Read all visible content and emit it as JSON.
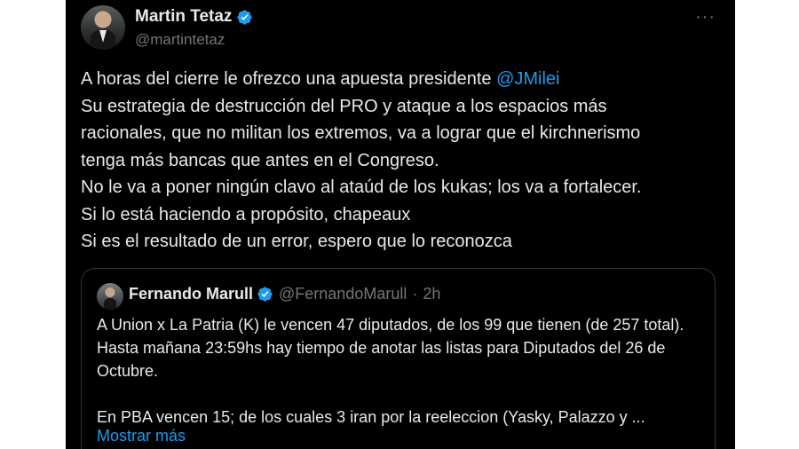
{
  "author": {
    "name": "Martin Tetaz",
    "handle": "@martintetaz"
  },
  "tweet": {
    "lines": [
      "A horas del cierre le ofrezco una apuesta presidente ",
      "@JMilei",
      "Su estrategia de destrucción del PRO y ataque a los espacios más",
      "racionales, que no militan los extremos, va a lograr que el kirchnerismo",
      "tenga más bancas que antes en el Congreso.",
      "No le va a poner ningún clavo al ataúd de los kukas; los va a fortalecer.",
      "Si lo está haciendo a propósito, chapeaux",
      "Si es el resultado de un error, espero que lo reconozca"
    ]
  },
  "quote": {
    "name": "Fernando Marull",
    "handle": "@FernandoMarull",
    "separator": "·",
    "time": "2h",
    "paragraph1": "A Union x La Patria (K) le vencen 47 diputados, de los 99 que tienen (de 257 total). Hasta mañana 23:59hs hay tiempo de anotar las listas para Diputados del 26 de Octubre.",
    "paragraph2": " En PBA vencen 15; de los cuales 3 iran por la reeleccion (Yasky, Palazzo y ...",
    "show_more": "Mostrar más"
  },
  "more_glyph": "···",
  "colors": {
    "background": "#000000",
    "text": "#e7e9ea",
    "secondary": "#71767b",
    "accent": "#1d9bf0",
    "border": "#2f3336"
  },
  "icons": [
    "verified-badge-icon",
    "more-options-icon"
  ]
}
